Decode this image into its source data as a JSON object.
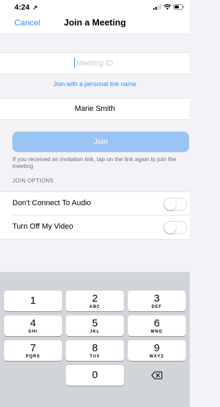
{
  "status_bar": {
    "time": "4:24",
    "location_glyph": "↗"
  },
  "nav": {
    "cancel_label": "Cancel",
    "title": "Join a Meeting"
  },
  "meeting_id": {
    "placeholder": "Meeting ID",
    "value": ""
  },
  "personal_link_label": "Join with a personal link name",
  "name_value": "Marie Smith",
  "join_label": "Join",
  "invite_hint": "If you received an invitation link, tap on the link again to join the meeting",
  "join_options": {
    "header": "JOIN OPTIONS",
    "items": [
      {
        "label": "Don't Connect To Audio",
        "enabled": false
      },
      {
        "label": "Turn Off My Video",
        "enabled": false
      }
    ]
  },
  "keypad": {
    "keys": [
      {
        "digit": "1",
        "letters": ""
      },
      {
        "digit": "2",
        "letters": "ABC"
      },
      {
        "digit": "3",
        "letters": "DEF"
      },
      {
        "digit": "4",
        "letters": "GHI"
      },
      {
        "digit": "5",
        "letters": "JKL"
      },
      {
        "digit": "6",
        "letters": "MNO"
      },
      {
        "digit": "7",
        "letters": "PQRS"
      },
      {
        "digit": "8",
        "letters": "TUV"
      },
      {
        "digit": "9",
        "letters": "WXYZ"
      },
      {
        "digit": "0",
        "letters": ""
      }
    ],
    "delete_icon": "backspace-icon"
  },
  "colors": {
    "accent": "#2d8cff",
    "join_disabled": "#9ac4f4",
    "keyboard_bg": "#d1d4d9"
  }
}
